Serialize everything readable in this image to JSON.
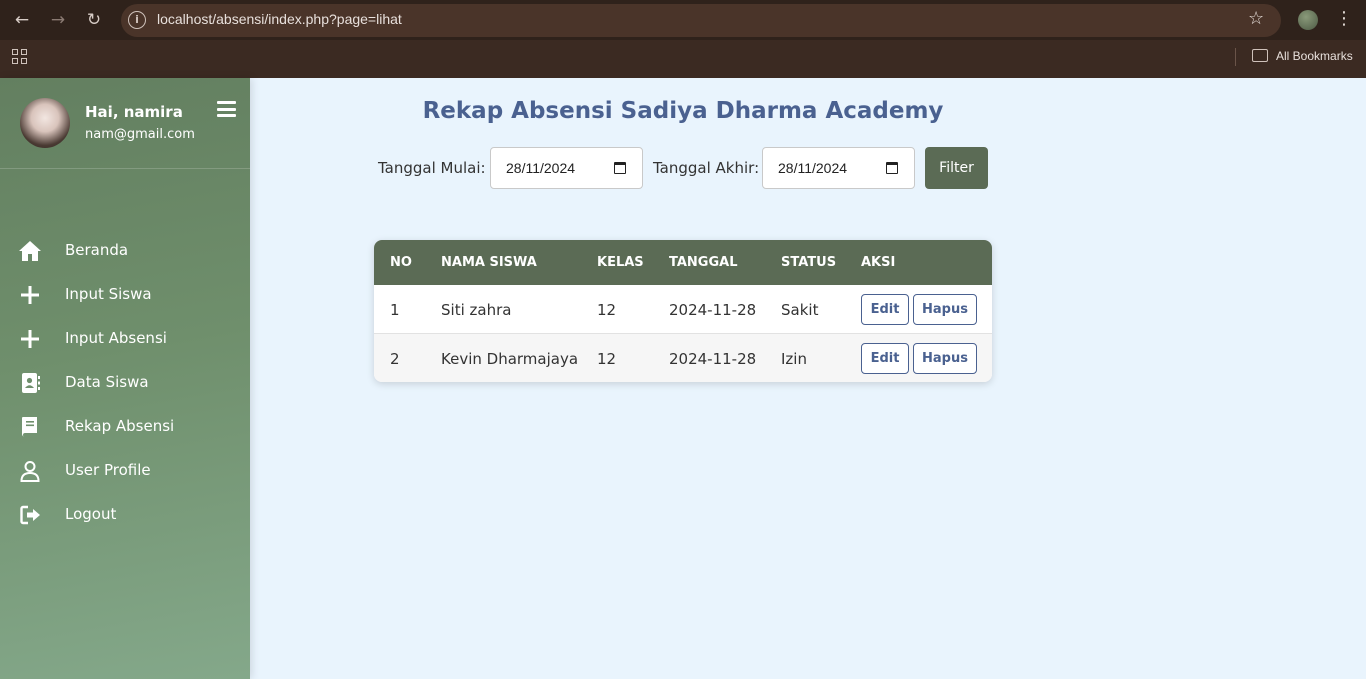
{
  "browser": {
    "url": "localhost/absensi/index.php?page=lihat",
    "bookmarks_label": "All Bookmarks"
  },
  "sidebar": {
    "greeting": "Hai, namira",
    "email": "nam@gmail.com",
    "items": [
      {
        "label": "Beranda",
        "icon": "home-icon"
      },
      {
        "label": "Input Siswa",
        "icon": "plus-icon"
      },
      {
        "label": "Input Absensi",
        "icon": "plus-icon"
      },
      {
        "label": "Data Siswa",
        "icon": "address-book-icon"
      },
      {
        "label": "Rekap Absensi",
        "icon": "book-icon"
      },
      {
        "label": "User Profile",
        "icon": "user-icon"
      },
      {
        "label": "Logout",
        "icon": "logout-icon"
      }
    ]
  },
  "main": {
    "title": "Rekap Absensi Sadiya Dharma Academy",
    "filter": {
      "start_label": "Tanggal Mulai:",
      "start_value": "28/11/2024",
      "end_label": "Tanggal Akhir:",
      "end_value": "28/11/2024",
      "button_label": "Filter"
    },
    "table": {
      "headers": [
        "NO",
        "NAMA SISWA",
        "KELAS",
        "TANGGAL",
        "STATUS",
        "AKSI"
      ],
      "rows": [
        {
          "no": "1",
          "nama": "Siti zahra",
          "kelas": "12",
          "tanggal": "2024-11-28",
          "status": "Sakit"
        },
        {
          "no": "2",
          "nama": "Kevin Dharmajaya",
          "kelas": "12",
          "tanggal": "2024-11-28",
          "status": "Izin"
        }
      ],
      "edit_label": "Edit",
      "delete_label": "Hapus"
    }
  },
  "colors": {
    "accent": "#5b6b55",
    "title": "#4a6190",
    "background": "#e9f4fd"
  }
}
